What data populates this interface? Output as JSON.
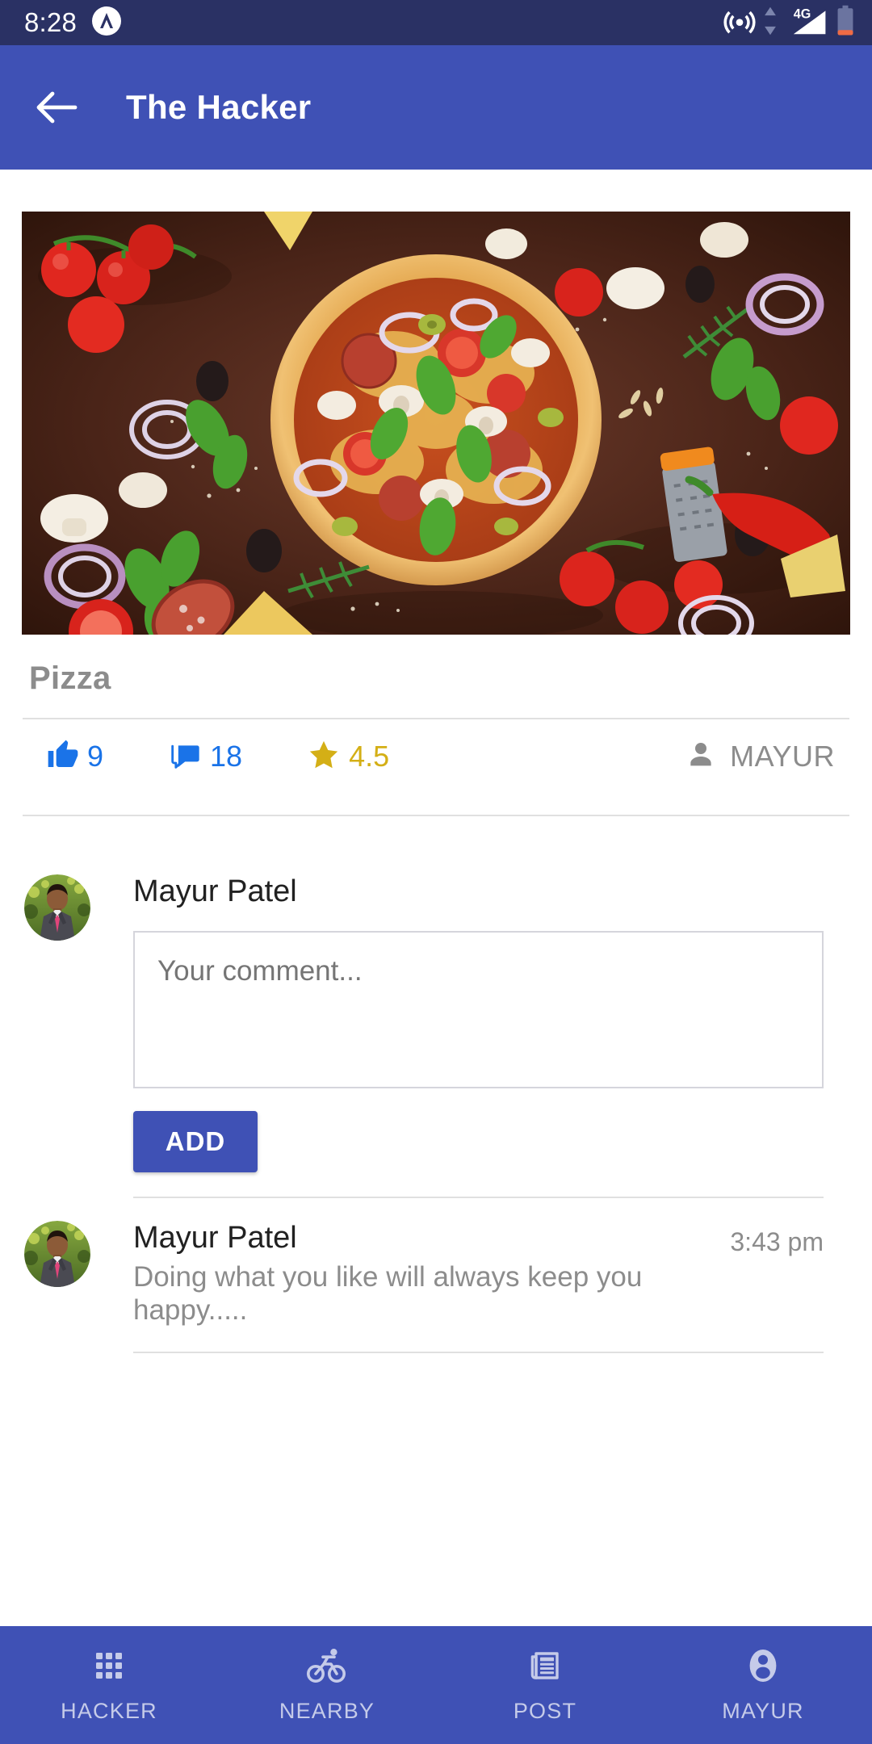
{
  "status_bar": {
    "time": "8:28",
    "icons": [
      "app-logo-icon",
      "hotspot-icon",
      "data-transfer-icon",
      "signal-4g-icon",
      "battery-low-icon"
    ],
    "network_label": "4G",
    "background_color": "#2a3164"
  },
  "app_bar": {
    "title": "The Hacker",
    "back_icon": "arrow-left-icon",
    "background_color": "#3f51b5",
    "text_color": "#ffffff"
  },
  "post": {
    "image_alt": "pizza-photo",
    "title": "Pizza",
    "stats": {
      "likes_icon": "thumbs-up-icon",
      "likes": "9",
      "comments_icon": "comment-bubbles-icon",
      "comments": "18",
      "rating_icon": "star-icon",
      "rating": "4.5",
      "author_icon": "person-icon",
      "author": "MAYUR",
      "like_color": "#1a73e8",
      "comment_color": "#1a73e8",
      "rating_color": "#d4af16",
      "author_color": "#8c8c8c"
    }
  },
  "composer": {
    "avatar": "user-avatar",
    "name": "Mayur Patel",
    "placeholder": "Your comment...",
    "value": "",
    "add_label": "ADD",
    "add_button_color": "#3f51b5"
  },
  "comments": [
    {
      "avatar": "user-avatar",
      "author": "Mayur Patel",
      "time": "3:43 pm",
      "text": "Doing what you like will always keep you happy....."
    }
  ],
  "bottom_nav": {
    "background_color": "#3f51b5",
    "items": [
      {
        "label": "HACKER",
        "icon": "apps-grid-icon"
      },
      {
        "label": "NEARBY",
        "icon": "bicycle-icon"
      },
      {
        "label": "POST",
        "icon": "newspaper-icon"
      },
      {
        "label": "MAYUR",
        "icon": "account-circle-icon"
      }
    ]
  }
}
